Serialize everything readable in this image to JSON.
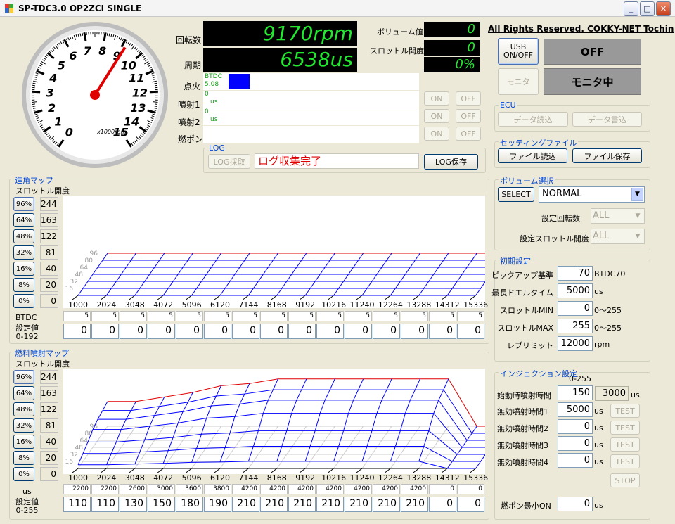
{
  "window": {
    "title": "SP-TDC3.0 OP2ZCI SINGLE",
    "icon": "app-icon"
  },
  "gauge": {
    "numbers": [
      "0",
      "1",
      "2",
      "3",
      "4",
      "5",
      "6",
      "7",
      "8",
      "9",
      "10",
      "11",
      "12",
      "13",
      "14",
      "15"
    ],
    "unit": "x1000rpm",
    "rpm": 9170
  },
  "readouts": {
    "rpm_label": "回転数",
    "rpm_value": "9170rpm",
    "period_label": "周期",
    "period_value": "6538us",
    "volume_label": "ボリューム値",
    "volume_value": "0",
    "throttle_label": "スロットル開度",
    "throttle_value": "0",
    "throttle_pct": "0%"
  },
  "rows": {
    "ignition_label": "点火",
    "ignition_btdc": "BTDC",
    "ignition_value": "5.08",
    "inj1_label": "噴射1",
    "inj1_value": "0",
    "inj1_unit": "us",
    "inj2_label": "噴射2",
    "inj2_value": "0",
    "inj2_unit": "us",
    "fuelpump_label": "燃ポン"
  },
  "onoff": {
    "on": "ON",
    "off": "OFF"
  },
  "log": {
    "title": "LOG",
    "capture": "LOG採取",
    "status": "ログ収集完了",
    "save": "LOG保存"
  },
  "copyright": "All Rights Reserved. COKKY-NET Tochin",
  "usb": {
    "button": "USB\nON/OFF",
    "status": "OFF"
  },
  "monitor": {
    "button": "モニタ",
    "status": "モニタ中"
  },
  "ecu": {
    "title": "ECU",
    "read": "データ読込",
    "write": "データ書込"
  },
  "setting_file": {
    "title": "セッティングファイル",
    "read": "ファイル読込",
    "save": "ファイル保存"
  },
  "volume_sel": {
    "title": "ボリューム選択",
    "select": "SELECT",
    "mode": "NORMAL",
    "rpm_label": "設定回転数",
    "rpm_val": "ALL",
    "thr_label": "設定スロットル開度",
    "thr_val": "ALL"
  },
  "initial": {
    "title": "初期設定",
    "rows": [
      {
        "label": "ピックアップ基準",
        "value": "70",
        "unit": "BTDC70"
      },
      {
        "label": "最長ドエルタイム",
        "value": "5000",
        "unit": "us"
      },
      {
        "label": "スロットルMIN",
        "value": "0",
        "unit": "0～255"
      },
      {
        "label": "スロットルMAX",
        "value": "255",
        "unit": "0～255"
      },
      {
        "label": "レブリミット",
        "value": "12000",
        "unit": "rpm"
      }
    ]
  },
  "injection": {
    "title": "インジェクション設定",
    "range": "0-255",
    "start_label": "始動時噴射時間",
    "start_value": "150",
    "start_us": "3000",
    "us": "us",
    "rows": [
      {
        "label": "無効噴射時間1",
        "value": "5000"
      },
      {
        "label": "無効噴射時間2",
        "value": "0"
      },
      {
        "label": "無効噴射時間3",
        "value": "0"
      },
      {
        "label": "無効噴射時間4",
        "value": "0"
      }
    ],
    "test": "TEST",
    "stop": "STOP",
    "pump_label": "燃ポン最小ON",
    "pump_value": "0"
  },
  "maps": {
    "throttle_label": "スロットル開度",
    "throttle_buttons": [
      "96%",
      "64%",
      "48%",
      "32%",
      "16%",
      "8%",
      "0%"
    ],
    "throttle_values": [
      "244",
      "163",
      "122",
      "81",
      "40",
      "20",
      "0"
    ],
    "rpm_axis": [
      "1000",
      "2024",
      "3048",
      "4072",
      "5096",
      "6120",
      "7144",
      "8168",
      "9192",
      "10216",
      "11240",
      "12264",
      "13288",
      "14312",
      "15336"
    ],
    "z_labels": [
      "96",
      "80",
      "64",
      "48",
      "32",
      "16"
    ],
    "ignition": {
      "title": "進角マップ",
      "row1_label": "BTDC",
      "row1": [
        "5",
        "5",
        "5",
        "5",
        "5",
        "5",
        "5",
        "5",
        "5",
        "5",
        "5",
        "5",
        "5",
        "5",
        "5"
      ],
      "row2_label": "設定値\n0-192",
      "row2": [
        "0",
        "0",
        "0",
        "0",
        "0",
        "0",
        "0",
        "0",
        "0",
        "0",
        "0",
        "0",
        "0",
        "0",
        "0"
      ]
    },
    "fuel": {
      "title": "燃料噴射マップ",
      "row1_label": "us",
      "row1": [
        "2200",
        "2200",
        "2600",
        "3000",
        "3600",
        "3800",
        "4200",
        "4200",
        "4200",
        "4200",
        "4200",
        "4200",
        "4200",
        "0",
        "0"
      ],
      "row2_label": "設定値\n0-255",
      "row2": [
        "110",
        "110",
        "130",
        "150",
        "180",
        "190",
        "210",
        "210",
        "210",
        "210",
        "210",
        "210",
        "210",
        "0",
        "0"
      ]
    }
  }
}
